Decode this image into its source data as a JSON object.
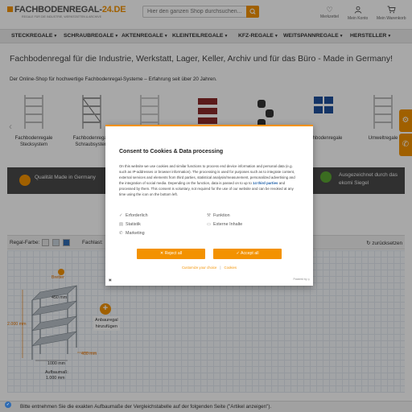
{
  "header": {
    "logo_main": "FACHBODENREGAL-",
    "logo_suffix": "24.DE",
    "logo_tagline": "REGALE FÜR DIE INDUSTRIE, WERKSTATTEN & ARCHIVE",
    "search_placeholder": "Hier den ganzen Shop durchsuchen...",
    "icons": [
      {
        "label": "Merkzettel",
        "icon": "heart-icon"
      },
      {
        "label": "Mein Konto",
        "icon": "user-icon"
      },
      {
        "label": "Mein Warenkorb",
        "icon": "cart-icon"
      }
    ]
  },
  "nav": [
    "STECKREGALE",
    "SCHRAUBREGALE",
    "AKTENREGALE",
    "KLEINTEILREGALE",
    "KFZ-REGALE",
    "WEITSPANNREGALE",
    "HERSTELLER"
  ],
  "page": {
    "title": "Fachbodenregal für die Industrie, Werkstatt, Lager, Keller, Archiv und für das Büro - Made in Germany!",
    "subtitle": "Der Online-Shop für hochwertige Fachbodenregal-Systeme – Erfahrung seit über 20 Jahren."
  },
  "products": [
    {
      "label": "Fachbodenregale Stecksystem"
    },
    {
      "label": "Fachbodenregale Schraubsystem"
    },
    {
      "label": ""
    },
    {
      "label": ""
    },
    {
      "label": ""
    },
    {
      "label": "Fachbodenregale"
    },
    {
      "label": "Umweltregale"
    }
  ],
  "banner": {
    "left": "Qualität Made in Germany",
    "right": "Ausgezeichnet durch das ekomi Siegel"
  },
  "configurator": {
    "color_label": "Regal-Farbe:",
    "shelf_label": "Fachlast:",
    "reset": "zurücksetzen",
    "swatches": [
      "#e6e6e6",
      "#c9d3dc",
      "#2f6bb2"
    ],
    "dims": {
      "shelves_label": "Bretter",
      "height": "2.000 mm",
      "depth_top": "450 mm",
      "width": "1000 mm",
      "depth_bottom": "400 mm",
      "assembly": "Aufbaumaß:",
      "assembly_val": "1.000 mm"
    },
    "add_label_1": "Anbauregal",
    "add_label_2": "hinzufügen"
  },
  "hint": "Bitte entnehmen Sie die exakten Aufbaumaße der Vergleichstabelle auf der folgenden Seite (\"Artikel anzeigen\").",
  "consent": {
    "title": "Consent to Cookies & Data processing",
    "body": "On this website we use cookies and similar functions to process end device information and personal data (e.g. such as IP-addresses or browser information). The processing is used for purposes such as to integrate content, external services and elements from third parties, statistical analysis/measurement, personalized advertising and the integration of social media. Depending on the function, data is passed on to up to",
    "body_link": "14 third parties",
    "body_tail": "and processed by them. This consent is voluntary, not required for the use of our website and can be revoked at any time using the icon on the bottom left.",
    "options": [
      {
        "label": "Erforderlich",
        "icon": "check-icon"
      },
      {
        "label": "Funktion",
        "icon": "wrench-icon"
      },
      {
        "label": "Statistik",
        "icon": "chart-icon"
      },
      {
        "label": "Externe Inhalte",
        "icon": "monitor-icon"
      },
      {
        "label": "Marketing",
        "icon": "megaphone-icon"
      }
    ],
    "reject": "Reject all",
    "accept": "Accept all",
    "link_customize": "Customize your choice",
    "link_cookies": "Cookies",
    "powered": "Powered by"
  },
  "colors": {
    "brand": "#f39200",
    "banner": "#4a4a4a",
    "link": "#1d5fa8"
  }
}
